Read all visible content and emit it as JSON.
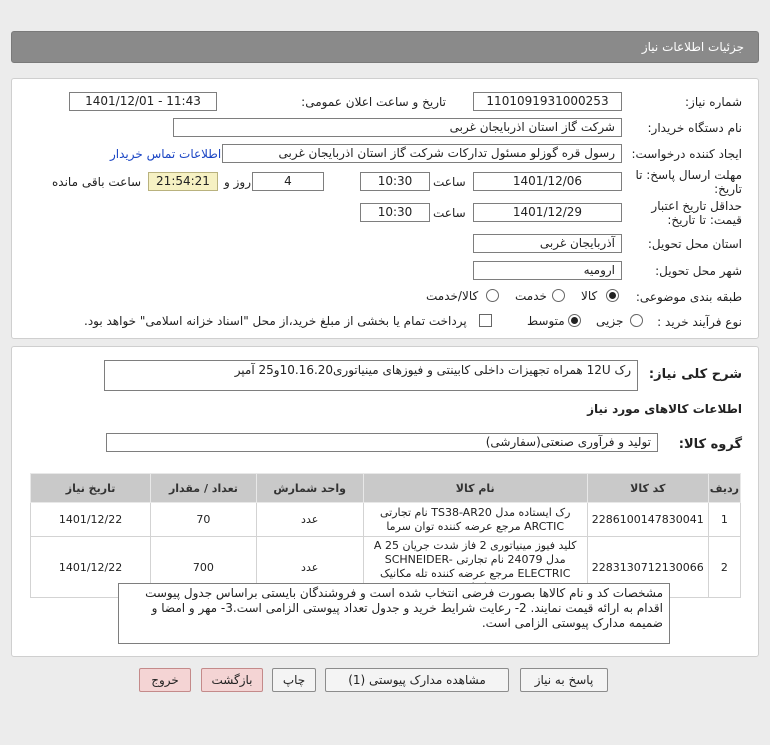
{
  "header": {
    "title": "جزئیات اطلاعات نیاز"
  },
  "form": {
    "need_number_label": "شماره نیاز:",
    "need_number": "1101091931000253",
    "announce_label": "تاریخ و ساعت اعلان عمومی:",
    "announce_value": "1401/12/01 - 11:43",
    "buyer_org_label": "نام دستگاه خریدار:",
    "buyer_org": "شرکت گاز استان اذربایجان غربی",
    "requester_label": "ایجاد کننده درخواست:",
    "requester": "رسول قره گوزلو مسئول تدارکات شرکت گاز استان اذربایجان غربی",
    "contact_link": "اطلاعات تماس خریدار",
    "deadline_label_1": "مهلت ارسال پاسخ: تا",
    "deadline_label_2": "تاریخ:",
    "deadline_date": "1401/12/06",
    "time_label": "ساعت",
    "deadline_time": "10:30",
    "days_value": "4",
    "days_label": "روز و",
    "remaining_time": "21:54:21",
    "remaining_label": "ساعت باقی مانده",
    "validity_label_1": "حداقل تاریخ اعتبار",
    "validity_label_2": "قیمت: تا تاریخ:",
    "validity_date": "1401/12/29",
    "validity_time": "10:30",
    "province_label": "استان محل تحویل:",
    "province": "آذربایجان غربی",
    "city_label": "شهر محل تحویل:",
    "city": "ارومیه",
    "category_label": "طبقه بندی موضوعی:",
    "category_options": [
      "کالا",
      "خدمت",
      "کالا/خدمت"
    ],
    "category_selected": "کالا",
    "process_label": "نوع فرآیند خرید :",
    "process_options": [
      "جزیی",
      "متوسط"
    ],
    "process_selected": "متوسط",
    "payment_note": "پرداخت تمام یا بخشی از مبلغ خرید،از محل \"اسناد خزانه اسلامی\" خواهد بود."
  },
  "summary": {
    "label": "شرح کلی نیاز:",
    "value": "رک 12U  همراه تجهیزات داخلی کابینتی و فیوزهای مینیاتوری10.16.20و25 آمپر"
  },
  "goods": {
    "section_title": "اطلاعات کالاهای مورد نیاز",
    "group_label": "گروه کالا:",
    "group_value": "تولید و فرآوری صنعتی(سفارشی)",
    "columns": [
      "ردیف",
      "کد کالا",
      "نام کالا",
      "واحد شمارش",
      "تعداد / مقدار",
      "تاریخ نیاز"
    ],
    "rows": [
      {
        "index": "1",
        "code": "2286100147830041",
        "name": "رک ایستاده مدل TS38-AR20 نام تجارتی ARCTIC مرجع عرضه کننده توان سرما",
        "unit": "عدد",
        "qty": "70",
        "date": "1401/12/22"
      },
      {
        "index": "2",
        "code": "2283130712130066",
        "name": "کلید فیوز مینیاتوری 2 فاز شدت جریان 25 A مدل 24079 نام تجارتی SCHNEIDER-ELECTRIC مرجع عرضه کننده تله مکانیک ایران",
        "unit": "عدد",
        "qty": "700",
        "date": "1401/12/22"
      }
    ]
  },
  "notes": "مشخصات کد و نام کالاها بصورت فرضی انتخاب شده است و فروشندگان بایستی براساس جدول پیوست اقدام به ارائه قیمت نمایند. 2- رعایت شرایط خرید و جدول تعداد پیوستی الزامی است.3- مهر و امضا و ضمیمه مدارک پیوستی الزامی است.",
  "buttons": {
    "reply": "پاسخ به نیاز",
    "attachments": "مشاهده مدارک پیوستی (1)",
    "print": "چاپ",
    "back": "بازگشت",
    "exit": "خروج"
  }
}
